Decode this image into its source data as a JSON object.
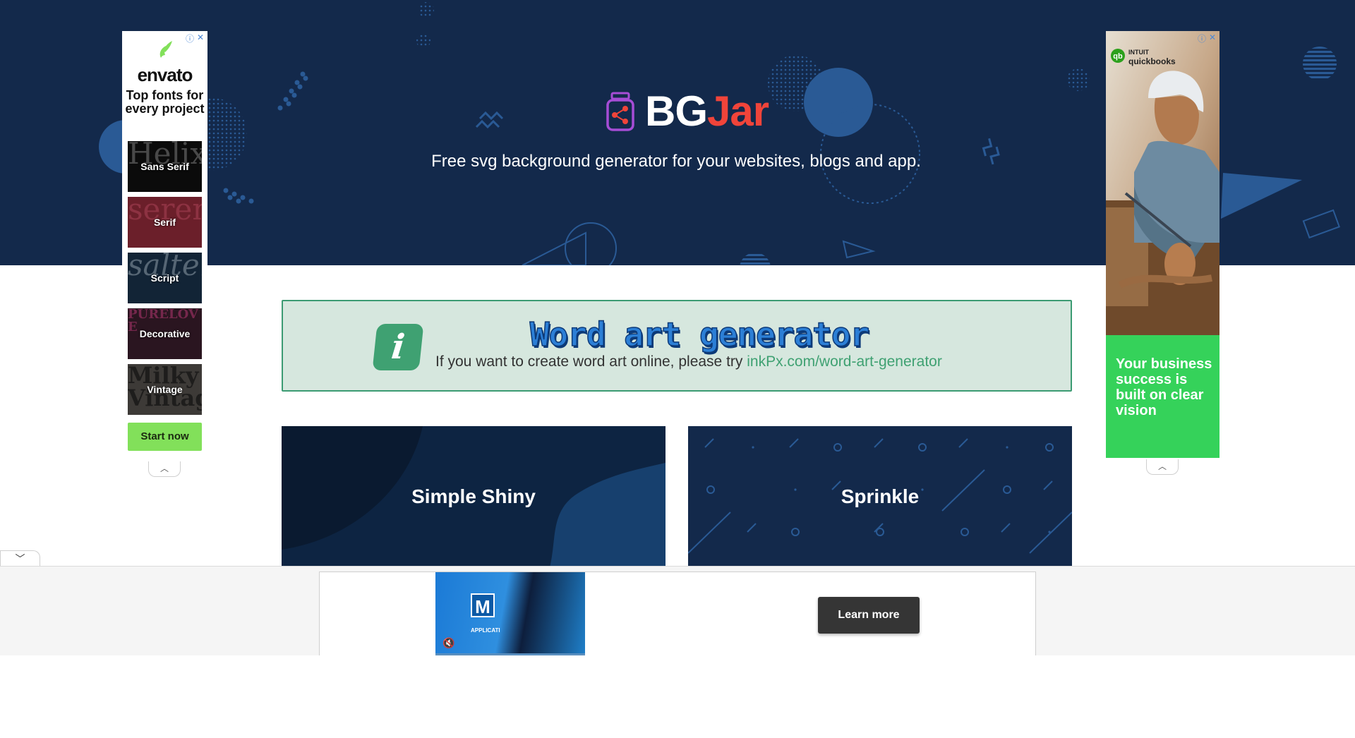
{
  "colors": {
    "hero_bg": "#13294b",
    "brand_accent": "#f0443a",
    "banner_bg": "#d6e7de",
    "banner_border": "#3c9b73",
    "link_green": "#3fa172",
    "card_bg": "#13294b"
  },
  "header": {
    "logo_icon": "jar-share-icon",
    "logo_part1": "BG",
    "logo_part2": "Jar",
    "tagline": "Free svg background generator for your websites, blogs and app."
  },
  "banner": {
    "icon": "info-i-icon",
    "icon_glyph": "i",
    "title": "Word art generator",
    "text": "If you want to create word art online, please try ",
    "link_text": "inkPx.com/word-art-generator"
  },
  "cards": [
    {
      "title": "Simple Shiny"
    },
    {
      "title": "Sprinkle"
    }
  ],
  "ad_left": {
    "brand": "envato",
    "headline": "Top fonts for every project",
    "tiles": [
      {
        "label": "Sans Serif",
        "bg_text": "Helixa",
        "bg": "#0b0b0b",
        "fg": "#888888"
      },
      {
        "label": "Serif",
        "bg_text": "seren",
        "bg": "#6b1f2a",
        "fg": "#b0465a"
      },
      {
        "label": "Script",
        "bg_text": "salter",
        "bg": "#122436",
        "fg": "#9aa7b3"
      },
      {
        "label": "Decorative",
        "bg_text": "PURELOVE",
        "bg": "#2a1520",
        "fg": "#c03a78"
      },
      {
        "label": "Vintage",
        "bg_text": "Milky Vintage",
        "bg": "#3d3a37",
        "fg": "#111111"
      }
    ],
    "cta": "Start now",
    "info_icon": "ad-info-icon",
    "close_icon": "close-icon",
    "collapse_icon": "chevron-up-icon"
  },
  "ad_right": {
    "brand_line1": "INTUIT",
    "brand_line2": "quickbooks",
    "headline": "Your business success is built on clear vision",
    "collapse_icon": "chevron-up-icon"
  },
  "bottom_ad": {
    "toggle_icon": "chevron-down-icon",
    "video_logo": "M",
    "video_caption": "APPLICATI",
    "cta": "Learn more",
    "mute_icon": "muted-speaker-icon"
  }
}
